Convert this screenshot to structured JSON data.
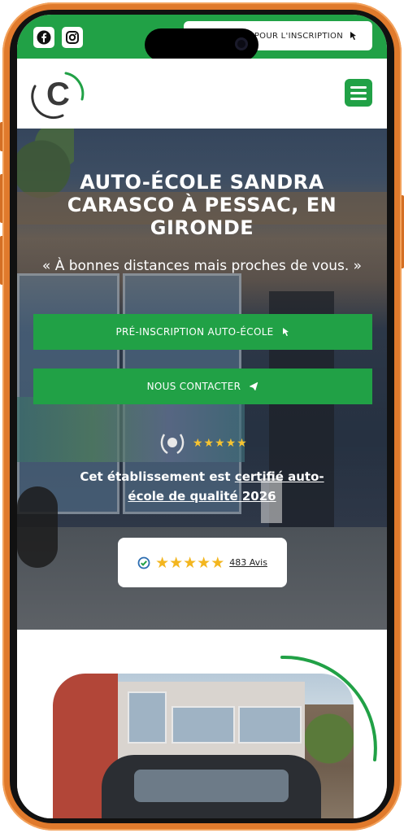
{
  "topbar": {
    "social": [
      {
        "name": "facebook-icon",
        "glyph": "f"
      },
      {
        "name": "instagram-icon",
        "glyph": "◎"
      }
    ],
    "cta_label": "POUR L'INSCRIPTION",
    "cta_icon": "cursor-icon",
    "accent": "#21a146"
  },
  "header": {
    "logo_letter": "C",
    "menu_icon": "hamburger-icon"
  },
  "hero": {
    "title": "AUTO-ÉCOLE SANDRA CARASCO À PESSAC, EN GIRONDE",
    "quote": "« À bonnes distances mais proches de vous. »",
    "buttons": [
      {
        "label": "PRÉ-INSCRIPTION AUTO-ÉCOLE",
        "icon": "cursor-icon"
      },
      {
        "label": "NOUS CONTACTER",
        "icon": "paper-plane-icon"
      }
    ],
    "award_stars": "★★★★★",
    "certified_prefix": "Cet établissement est ",
    "certified_link": "certifié auto-école de qualité 2026",
    "reviews": {
      "stars": "★★★★★",
      "rating_stars": 4.5,
      "count": "483 Avis"
    }
  }
}
